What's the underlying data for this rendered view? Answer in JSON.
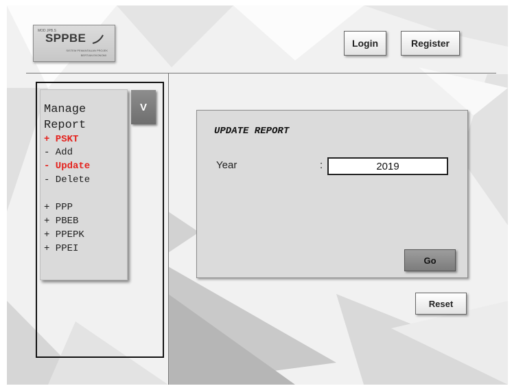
{
  "logo": {
    "small_text": "MOD JPB.S",
    "main_text": "SPPBE",
    "sub_text_1": "SISTEM PEMANTAUAN PROJEK",
    "sub_text_2": "BERTIAN EKONOMI"
  },
  "header": {
    "login_label": "Login",
    "register_label": "Register"
  },
  "sidebar": {
    "toggle_label": "V",
    "manage_line_1": "Manage",
    "manage_line_2": "Report",
    "items": [
      {
        "label": "+ PSKT",
        "active": true
      },
      {
        "label": "- Add",
        "active": false
      },
      {
        "label": "- Update",
        "active": true
      },
      {
        "label": "- Delete",
        "active": false
      },
      {
        "label": "+ PPP",
        "active": false
      },
      {
        "label": "+ PBEB",
        "active": false
      },
      {
        "label": "+ PPEPK",
        "active": false
      },
      {
        "label": "+ PPEI",
        "active": false
      }
    ]
  },
  "form": {
    "title": "UPDATE REPORT",
    "year_label": "Year",
    "colon": ":",
    "year_value": "2019",
    "go_label": "Go"
  },
  "reset_label": "Reset",
  "colors": {
    "accent_red": "#e4221d",
    "panel_gray": "#dbdbdb",
    "toggle_gray": "#7e7e7e"
  }
}
